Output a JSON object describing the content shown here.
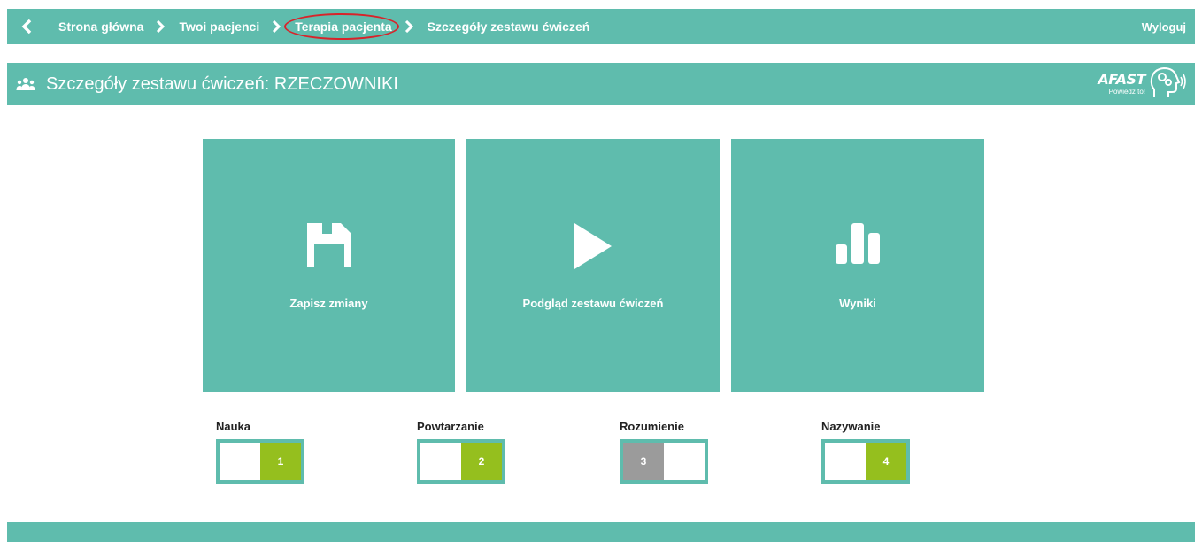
{
  "nav": {
    "breadcrumbs": [
      {
        "label": "Strona główna"
      },
      {
        "label": "Twoi pacjenci"
      },
      {
        "label": "Terapia pacjenta"
      },
      {
        "label": "Szczegóły zestawu ćwiczeń"
      }
    ],
    "logout_label": "Wyloguj"
  },
  "header": {
    "title": "Szczegóły zestawu ćwiczeń: RZECZOWNIKI",
    "logo_brand": "AFAST",
    "logo_tagline": "Powiedz to!"
  },
  "tiles": [
    {
      "label": "Zapisz zmiany",
      "icon": "floppy-disk-icon"
    },
    {
      "label": "Podgląd zestawu ćwiczeń",
      "icon": "play-icon"
    },
    {
      "label": "Wyniki",
      "icon": "bar-chart-icon"
    }
  ],
  "modes": [
    {
      "label": "Nauka",
      "number": "1",
      "state": "on"
    },
    {
      "label": "Powtarzanie",
      "number": "2",
      "state": "on"
    },
    {
      "label": "Rozumienie",
      "number": "3",
      "state": "off"
    },
    {
      "label": "Nazywanie",
      "number": "4",
      "state": "on"
    }
  ],
  "colors": {
    "teal": "#5fbcad",
    "toggle_on": "#95bf1e",
    "toggle_off": "#9b9b9b",
    "highlight": "#d8232a"
  }
}
